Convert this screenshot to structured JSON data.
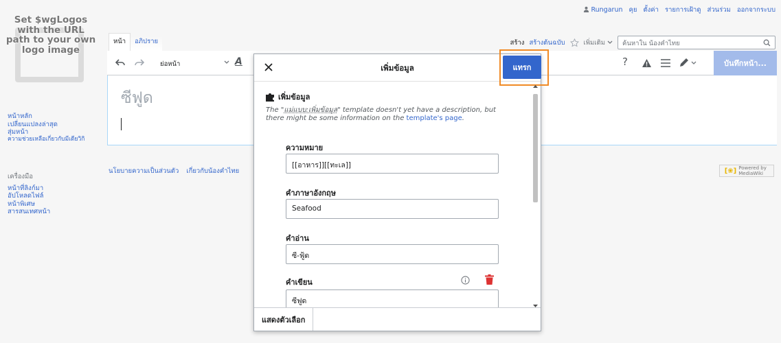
{
  "personal": {
    "user": "Rungarun",
    "items": [
      "คุย",
      "ตั้งค่า",
      "รายการเฝ้าดู",
      "ส่วนร่วม",
      "ออกจากระบบ"
    ]
  },
  "logo": {
    "text": "Set $wgLogos with the URL path to your own logo image"
  },
  "sidebar": {
    "nav": [
      "หน้าหลัก",
      "เปลี่ยนแปลงล่าสุด",
      "สุ่มหน้า",
      "ความช่วยเหลือเกี่ยวกับมีเดียวิกิ"
    ],
    "tools_heading": "เครื่องมือ",
    "tools": [
      "หน้าที่ลิงก์มา",
      "อัปโหลดไฟล์",
      "หน้าพิเศษ",
      "สารสนเทศหน้า"
    ]
  },
  "tabs": {
    "page": "หน้า",
    "discussion": "อภิปราย",
    "create": "สร้าง",
    "create_source": "สร้างต้นฉบับ",
    "more": "เพิ่มเติม"
  },
  "search": {
    "placeholder": "ค้นหาใน น้องคำไทย"
  },
  "toolbar": {
    "paragraph": "ย่อหน้า",
    "save": "บันทึกหน้า..."
  },
  "page": {
    "title": "ซีฟูด"
  },
  "footer": {
    "links": [
      "นโยบายความเป็นส่วนตัว",
      "เกี่ยวกับน้องคำไทย"
    ],
    "badge": "Powered by MediaWiki"
  },
  "dialog": {
    "title": "เพิ่มข้อมูล",
    "insert": "แทรก",
    "template_name": "เพิ่มข้อมูล",
    "desc_prefix": "The \"",
    "desc_tpl": "แม่แบบ:เพิ่มข้อมูล",
    "desc_mid": "\" template doesn't yet have a description, but there might be some information on the ",
    "desc_link": "template's page",
    "desc_end": ".",
    "fields": [
      {
        "label": "ความหมาย",
        "value": "[[อาหาร]][[ทะเล]]"
      },
      {
        "label": "คำภาษาอังกฤษ",
        "value": "Seafood"
      },
      {
        "label": "คำอ่าน",
        "value": "ซี-ฟู้ด"
      },
      {
        "label": "คำเขียน",
        "value": "ซีฟูด"
      }
    ],
    "show_options": "แสดงตัวเลือก"
  },
  "colors": {
    "link": "#3366cc",
    "accent": "#3366cc",
    "highlight": "#f08a24",
    "danger": "#d33"
  }
}
